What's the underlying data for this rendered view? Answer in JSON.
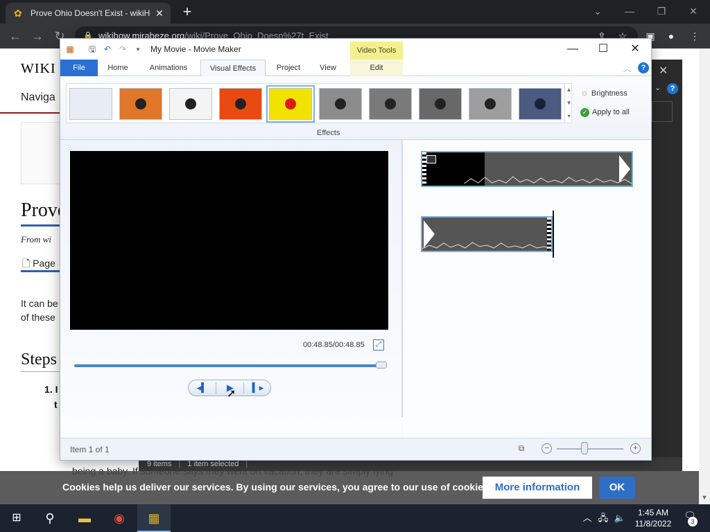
{
  "browser": {
    "tab_title": "Prove Ohio Doesn't Exist - wikiH",
    "tab_close": "✕",
    "new_tab": "+",
    "url_host": "wikihow.mirabeze.org",
    "url_path": "/wiki/Prove_Ohio_Doesn%27t_Exist"
  },
  "wiki": {
    "logo": "WIKI",
    "nav": "Naviga",
    "title": "Prove",
    "from": "From wi",
    "page_tab": "Page",
    "intro_line1": "It can be",
    "intro_line2": "of these",
    "steps_heading": "Steps",
    "step_number": "1. I",
    "step_bold": "t",
    "para_line": "being a baby. If someone says they went on vacation, they are simply lying",
    "bg_status_items": "9 items",
    "bg_status_selected": "1 item selected"
  },
  "movie_maker": {
    "window_title": "My Movie - Movie Maker",
    "contextual_tab_group": "Video Tools",
    "tabs": [
      "File",
      "Home",
      "Animations",
      "Visual Effects",
      "Project",
      "View",
      "Edit"
    ],
    "active_tab": "Visual Effects",
    "effects_group_label": "Effects",
    "brightness_label": "Brightness",
    "apply_all_label": "Apply to all",
    "effects": [
      {
        "name": "No effect",
        "color": "#e8edf3"
      },
      {
        "name": "Warm",
        "color": "#e0772a"
      },
      {
        "name": "Pale",
        "color": "#f4f4f4"
      },
      {
        "name": "Saturated",
        "color": "#e84a12"
      },
      {
        "name": "Threshold",
        "color": "#f2e200",
        "selected": true
      },
      {
        "name": "Grayscale 1",
        "color": "#8c8c8c"
      },
      {
        "name": "Grayscale 2",
        "color": "#7a7a7a"
      },
      {
        "name": "Grayscale 3",
        "color": "#686868"
      },
      {
        "name": "Grayscale 4",
        "color": "#9e9e9e"
      },
      {
        "name": "Cyanotype",
        "color": "#4a5a80"
      }
    ],
    "timecode": "00:48.85/00:48.85",
    "seek_progress": 1.0,
    "status_text": "Item 1 of 1",
    "zoom_level": 0.42
  },
  "cookie": {
    "message": "Cookies help us deliver our services. By using our services, you agree to our use of cookies.",
    "more_info": "More information",
    "ok": "OK"
  },
  "taskbar": {
    "time": "1:45 AM",
    "date": "11/8/2022",
    "notification_count": "3"
  },
  "colors": {
    "accent_blue": "#2a6fd3",
    "video_tools_yellow": "#f3ef8e",
    "cookie_button_blue": "#2f6ec7"
  }
}
